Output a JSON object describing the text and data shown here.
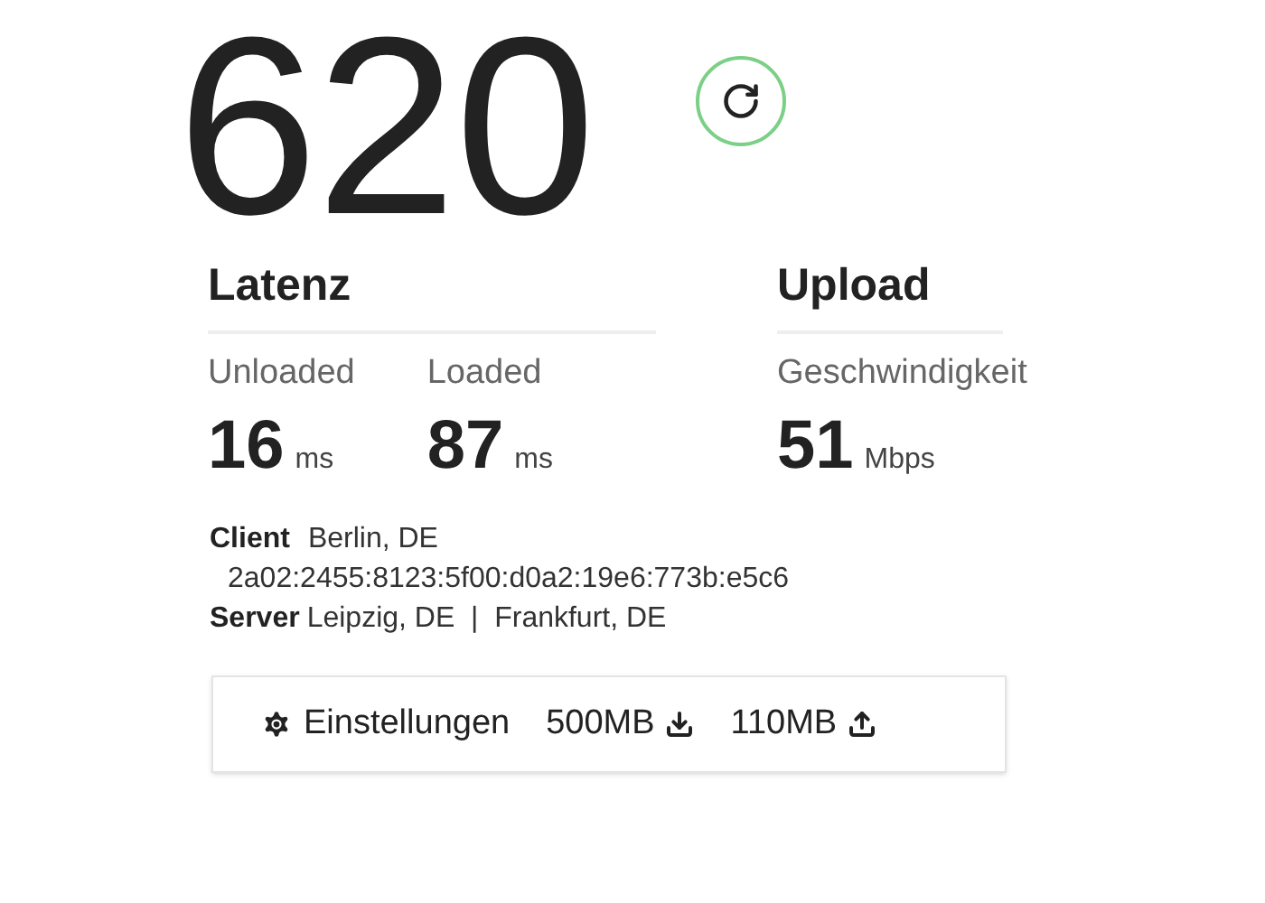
{
  "download": {
    "value": "620"
  },
  "latency": {
    "title": "Latenz",
    "metrics": [
      {
        "label": "Unloaded",
        "value": "16",
        "unit": "ms"
      },
      {
        "label": "Loaded",
        "value": "87",
        "unit": "ms"
      }
    ]
  },
  "upload": {
    "title": "Upload",
    "metrics": [
      {
        "label": "Geschwindigkeit",
        "value": "51",
        "unit": "Mbps"
      }
    ]
  },
  "connection": {
    "client_label": "Client",
    "client_location": "Berlin, DE",
    "client_ip": "2a02:2455:8123:5f00:d0a2:19e6:773b:e5c6",
    "server_label": "Server",
    "server_locations": "Leipzig, DE  |  Frankfurt, DE"
  },
  "settings_bar": {
    "settings": "Einstellungen",
    "download_size": "500MB",
    "upload_size": "110MB"
  }
}
